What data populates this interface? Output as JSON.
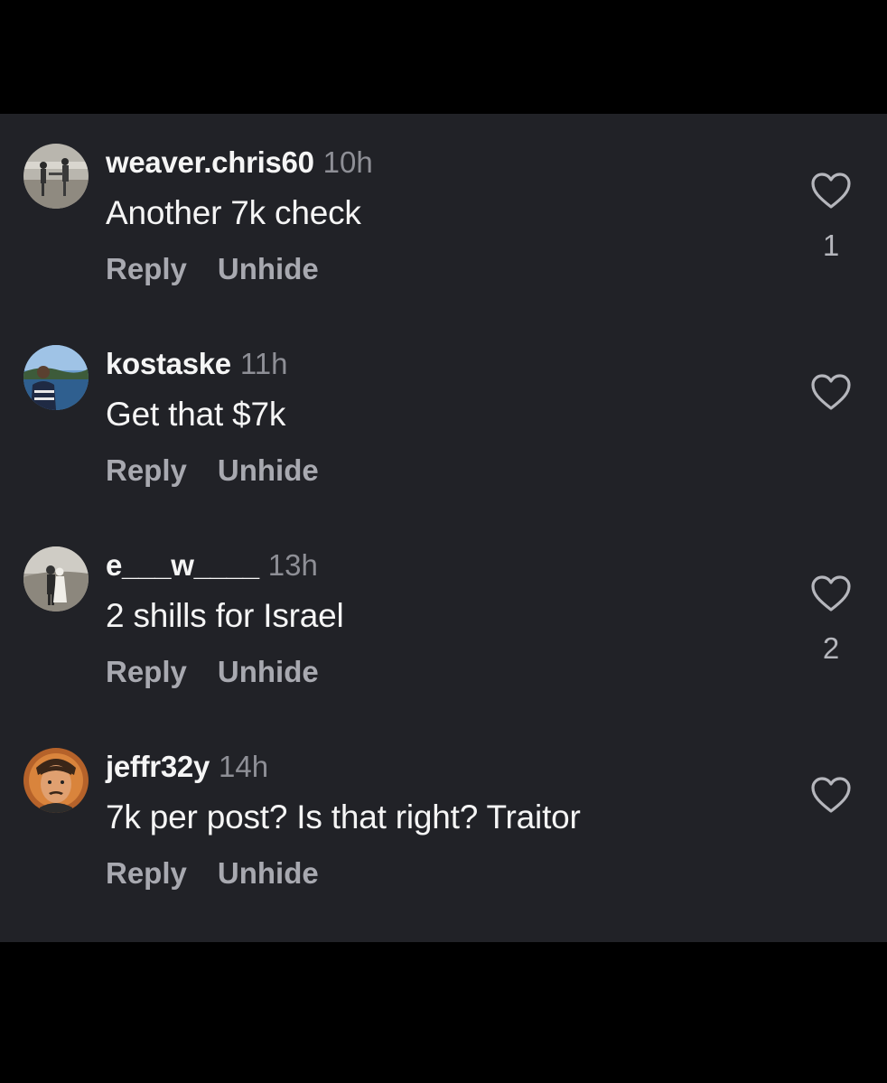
{
  "comments": [
    {
      "username": "weaver.chris60",
      "time": "10h",
      "text": "Another 7k check",
      "reply_label": "Reply",
      "unhide_label": "Unhide",
      "like_count": "1",
      "like_icon": "heart-outline-icon"
    },
    {
      "username": "kostaske",
      "time": "11h",
      "text": "Get that $7k",
      "reply_label": "Reply",
      "unhide_label": "Unhide",
      "like_count": "",
      "like_icon": "heart-outline-icon"
    },
    {
      "username": "e___w____",
      "time": "13h",
      "text": "2 shills for Israel",
      "reply_label": "Reply",
      "unhide_label": "Unhide",
      "like_count": "2",
      "like_icon": "heart-outline-icon"
    },
    {
      "username": "jeffr32y",
      "time": "14h",
      "text": "7k per post? Is that right? Traitor",
      "reply_label": "Reply",
      "unhide_label": "Unhide",
      "like_count": "",
      "like_icon": "heart-outline-icon"
    }
  ],
  "colors": {
    "background": "#000000",
    "panel": "#212227",
    "primary_text": "#f5f5f5",
    "secondary_text": "#8e8f96",
    "action_text": "#a8a9b0"
  }
}
